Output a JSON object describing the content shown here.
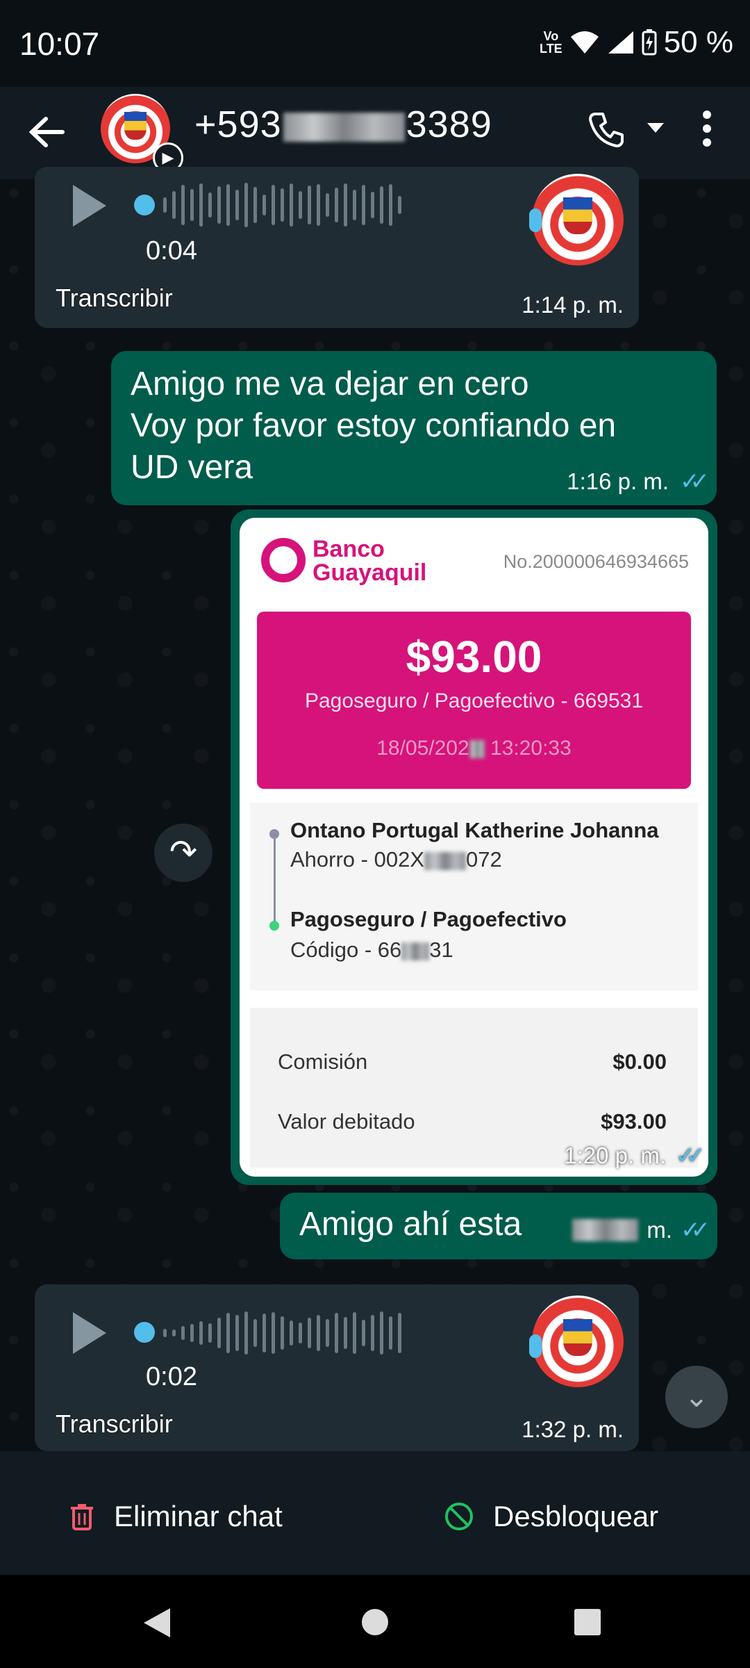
{
  "status_bar": {
    "time": "10:07",
    "volte": "Vo\nLTE",
    "battery": "50 %"
  },
  "header": {
    "contact_prefix": "+593",
    "contact_suffix": "3389"
  },
  "messages": {
    "voice1": {
      "duration": "0:04",
      "transcribe": "Transcribir",
      "time": "1:14 p. m."
    },
    "text1": {
      "lines": [
        "Amigo me va dejar en cero",
        "Voy por favor estoy confiando en",
        "UD vera"
      ],
      "time": "1:16 p. m."
    },
    "receipt": {
      "bank_line1": "Banco",
      "bank_line2": "Guayaquil",
      "number": "No.200000646934665",
      "amount": "$93.00",
      "desc": "Pagoseguro / Pagoefectivo - 669531",
      "date_prefix": "18/05/202",
      "date_suffix": "13:20:33",
      "from_name": "Ontano Portugal Katherine Johanna",
      "from_account_prefix": "Ahorro - 002X",
      "from_account_suffix": "072",
      "to_name": "Pagoseguro / Pagoefectivo",
      "to_code_prefix": "Código - 66",
      "to_code_suffix": "31",
      "fee_label": "Comisión",
      "fee_value": "$0.00",
      "debit_label": "Valor debitado",
      "debit_value": "$93.00",
      "time": "1:20 p. m."
    },
    "text2": {
      "text": "Amigo ahí esta",
      "time_suffix": "m."
    },
    "voice2": {
      "duration": "0:02",
      "transcribe": "Transcribir",
      "time": "1:32 p. m."
    }
  },
  "bottom_bar": {
    "delete_label": "Eliminar chat",
    "unblock_label": "Desbloquear"
  },
  "colors": {
    "outgoing_bubble": "#005c4b",
    "incoming_bubble": "#202c33",
    "bank_pink": "#d6137a",
    "read_ticks": "#53bdeb"
  }
}
